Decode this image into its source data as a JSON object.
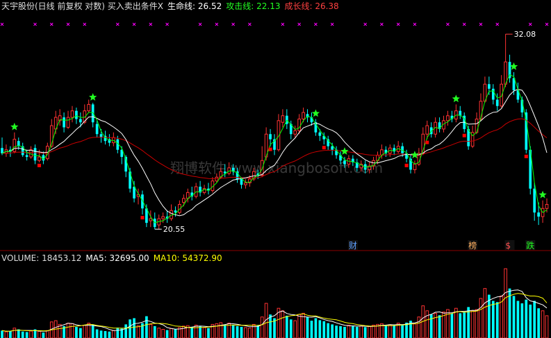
{
  "header": {
    "title": "天宇股份(日线 前复权 对数) 买入卖出条件X",
    "lifeline_label": "生命线: 26.52",
    "attack_label": "攻击线: 22.13",
    "growth_label": "成长线: 26.38"
  },
  "volume_header": {
    "volume_label": "VOLUME: 18453.12",
    "ma5_label": "MA5: 32695.00",
    "ma10_label": "MA10: 54372.90"
  },
  "watermark": "翔博软件 www.xiangbosoft.com",
  "annotations": {
    "high": "32.08",
    "low": "20.55"
  },
  "event_markers": [
    "财",
    "榜",
    "$",
    "跌"
  ],
  "colors": {
    "background": "#000000",
    "up": "#ff3232",
    "down": "#00ffff",
    "life_line": "#ffffff",
    "attack_line": "#00ff00",
    "growth_line": "#cc0000",
    "star": "#22ff22",
    "cross": "#ff00ff",
    "sell_dot": "#ff0000",
    "ma5": "#ffffff",
    "ma10": "#ffff00",
    "high_annotation": "#ff4040"
  },
  "chart_data": [
    {
      "type": "candlestick",
      "scale": "log",
      "ylim": [
        19.8,
        33.5
      ],
      "candles": [
        [
          24.7,
          24.4,
          25.3,
          24.3,
          0
        ],
        [
          24.4,
          24.6,
          24.9,
          24.2,
          0
        ],
        [
          24.6,
          24.5,
          24.8,
          24.2,
          0
        ],
        [
          24.5,
          25.2,
          25.6,
          24.4,
          0
        ],
        [
          25.1,
          24.8,
          25.3,
          24.6,
          0
        ],
        [
          24.8,
          24.3,
          25.0,
          24.2,
          0
        ],
        [
          24.3,
          24.2,
          24.6,
          24.0,
          0
        ],
        [
          24.2,
          24.6,
          24.8,
          24.1,
          0
        ],
        [
          24.7,
          24.0,
          24.9,
          23.8,
          0
        ],
        [
          24.0,
          24.2,
          24.6,
          23.9,
          0
        ],
        [
          24.3,
          24.0,
          24.5,
          23.8,
          0
        ],
        [
          24.1,
          24.8,
          25.0,
          24.0,
          0
        ],
        [
          24.8,
          26.0,
          26.4,
          24.7,
          0
        ],
        [
          25.8,
          26.5,
          26.9,
          25.5,
          0
        ],
        [
          26.3,
          26.6,
          27.0,
          26.0,
          0
        ],
        [
          26.5,
          25.9,
          26.8,
          25.6,
          0
        ],
        [
          25.9,
          26.5,
          26.9,
          25.8,
          0
        ],
        [
          26.5,
          26.9,
          27.2,
          26.2,
          0
        ],
        [
          26.9,
          26.4,
          27.1,
          26.1,
          0
        ],
        [
          26.4,
          26.2,
          26.8,
          25.9,
          0
        ],
        [
          26.2,
          26.9,
          27.3,
          26.1,
          0
        ],
        [
          26.9,
          27.3,
          27.6,
          26.8,
          0
        ],
        [
          27.3,
          26.2,
          27.4,
          25.9,
          0
        ],
        [
          26.1,
          25.5,
          26.3,
          25.3,
          0
        ],
        [
          25.5,
          25.3,
          25.8,
          25.0,
          0
        ],
        [
          25.4,
          25.1,
          25.7,
          24.9,
          0
        ],
        [
          25.2,
          25.0,
          25.5,
          24.8,
          0
        ],
        [
          25.0,
          25.3,
          25.6,
          24.8,
          0
        ],
        [
          25.2,
          24.6,
          25.4,
          24.4,
          0
        ],
        [
          24.6,
          24.2,
          24.8,
          23.8,
          0
        ],
        [
          24.2,
          23.4,
          24.3,
          23.1,
          0
        ],
        [
          23.4,
          22.5,
          23.6,
          22.3,
          0
        ],
        [
          22.6,
          22.0,
          22.9,
          21.8,
          0
        ],
        [
          22.1,
          22.2,
          22.5,
          21.7,
          0
        ],
        [
          22.2,
          21.5,
          22.4,
          21.2,
          0
        ],
        [
          21.5,
          20.8,
          21.7,
          20.6,
          0
        ],
        [
          20.9,
          21.0,
          21.4,
          20.6,
          0
        ],
        [
          21.0,
          20.6,
          21.3,
          20.5,
          0
        ],
        [
          20.7,
          21.0,
          21.2,
          20.5,
          0
        ],
        [
          21.0,
          21.1,
          21.3,
          20.8,
          0
        ],
        [
          21.1,
          21.0,
          21.4,
          20.8,
          0
        ],
        [
          21.0,
          21.4,
          21.7,
          20.9,
          0
        ],
        [
          21.4,
          21.3,
          21.6,
          21.1,
          0
        ],
        [
          21.3,
          21.7,
          21.9,
          21.2,
          0
        ],
        [
          21.8,
          22.0,
          22.2,
          21.6,
          0
        ],
        [
          22.0,
          22.3,
          22.5,
          21.8,
          0
        ],
        [
          22.3,
          22.1,
          22.6,
          21.9,
          0
        ],
        [
          22.1,
          22.6,
          22.8,
          22.0,
          0
        ],
        [
          22.6,
          22.3,
          22.9,
          22.1,
          0
        ],
        [
          22.3,
          22.5,
          22.7,
          22.2,
          0
        ],
        [
          22.5,
          22.4,
          22.8,
          22.2,
          0
        ],
        [
          22.4,
          22.9,
          23.1,
          22.3,
          0
        ],
        [
          22.9,
          23.1,
          23.3,
          22.8,
          0
        ],
        [
          23.1,
          23.4,
          23.6,
          23.0,
          0
        ],
        [
          23.4,
          23.3,
          23.8,
          23.1,
          0
        ],
        [
          23.3,
          23.6,
          23.9,
          23.2,
          0
        ],
        [
          23.6,
          23.4,
          23.8,
          23.2,
          0
        ],
        [
          23.4,
          23.0,
          23.6,
          22.8,
          0
        ],
        [
          23.0,
          22.7,
          23.1,
          22.5,
          0
        ],
        [
          22.7,
          22.8,
          23.0,
          22.5,
          0
        ],
        [
          22.8,
          23.0,
          23.2,
          22.6,
          0
        ],
        [
          23.0,
          23.4,
          23.6,
          22.9,
          0
        ],
        [
          23.3,
          23.2,
          23.5,
          23.0,
          0
        ],
        [
          23.2,
          24.0,
          24.8,
          23.1,
          0
        ],
        [
          24.2,
          25.5,
          25.9,
          24.0,
          0
        ],
        [
          25.5,
          25.2,
          25.8,
          24.8,
          0
        ],
        [
          25.2,
          24.6,
          25.5,
          24.3,
          0
        ],
        [
          24.6,
          26.3,
          26.7,
          24.5,
          0
        ],
        [
          26.2,
          26.6,
          27.0,
          25.9,
          0
        ],
        [
          26.6,
          26.1,
          27.0,
          25.8,
          0
        ],
        [
          26.1,
          25.5,
          26.3,
          25.2,
          0
        ],
        [
          25.5,
          25.7,
          26.0,
          25.3,
          0
        ],
        [
          25.7,
          26.4,
          26.7,
          25.5,
          0
        ],
        [
          26.4,
          26.8,
          27.1,
          26.2,
          0
        ],
        [
          26.7,
          26.5,
          27.0,
          26.2,
          0
        ],
        [
          26.5,
          26.2,
          26.8,
          26.0,
          0
        ],
        [
          26.2,
          25.6,
          26.4,
          25.4,
          0
        ],
        [
          25.6,
          25.4,
          25.8,
          25.1,
          0
        ],
        [
          25.4,
          25.2,
          25.6,
          24.9,
          0
        ],
        [
          25.2,
          24.8,
          25.4,
          24.6,
          0
        ],
        [
          24.8,
          24.6,
          25.0,
          24.3,
          0
        ],
        [
          24.6,
          24.3,
          24.8,
          24.1,
          0
        ],
        [
          24.3,
          24.0,
          24.5,
          23.8,
          0
        ],
        [
          24.0,
          23.8,
          24.2,
          23.6,
          0
        ],
        [
          23.8,
          24.1,
          24.3,
          23.6,
          0
        ],
        [
          24.1,
          23.9,
          24.3,
          23.7,
          0
        ],
        [
          23.9,
          23.6,
          24.1,
          23.4,
          0
        ],
        [
          23.6,
          23.8,
          24.0,
          23.4,
          0
        ],
        [
          23.8,
          23.5,
          24.0,
          23.3,
          0
        ],
        [
          23.5,
          23.7,
          23.9,
          23.3,
          0
        ],
        [
          23.7,
          24.0,
          24.2,
          23.5,
          0
        ],
        [
          24.0,
          24.3,
          24.5,
          23.8,
          0
        ],
        [
          24.3,
          24.6,
          24.9,
          24.1,
          0
        ],
        [
          24.6,
          24.4,
          24.8,
          24.2,
          0
        ],
        [
          24.4,
          24.7,
          24.9,
          24.2,
          0
        ],
        [
          24.7,
          24.5,
          24.9,
          24.3,
          0
        ],
        [
          24.5,
          24.8,
          25.1,
          24.4,
          0
        ],
        [
          24.8,
          24.4,
          25.0,
          24.2,
          0
        ],
        [
          24.4,
          24.1,
          24.6,
          23.9,
          0
        ],
        [
          24.1,
          23.5,
          24.3,
          23.3,
          0
        ],
        [
          23.5,
          23.8,
          24.0,
          23.3,
          0
        ],
        [
          23.8,
          24.4,
          24.7,
          23.7,
          0
        ],
        [
          24.4,
          25.5,
          25.9,
          24.3,
          0
        ],
        [
          25.5,
          26.0,
          26.3,
          25.2,
          0
        ],
        [
          25.9,
          25.5,
          26.2,
          25.3,
          0
        ],
        [
          25.5,
          26.2,
          26.5,
          25.3,
          0
        ],
        [
          26.2,
          25.8,
          26.5,
          25.6,
          0
        ],
        [
          25.8,
          26.3,
          26.6,
          25.6,
          0
        ],
        [
          26.3,
          26.6,
          26.9,
          26.0,
          0
        ],
        [
          26.6,
          26.4,
          26.9,
          26.2,
          0
        ],
        [
          26.4,
          26.9,
          27.3,
          26.2,
          0
        ],
        [
          26.9,
          26.6,
          27.2,
          26.4,
          0
        ],
        [
          26.6,
          25.8,
          26.8,
          25.6,
          0
        ],
        [
          25.8,
          24.8,
          26.0,
          24.6,
          0
        ],
        [
          24.8,
          25.6,
          26.0,
          24.7,
          0
        ],
        [
          25.6,
          26.4,
          26.8,
          25.5,
          0
        ],
        [
          26.4,
          27.5,
          28.0,
          26.3,
          0
        ],
        [
          27.5,
          28.6,
          29.1,
          27.4,
          0
        ],
        [
          28.6,
          28.3,
          29.1,
          27.9,
          0
        ],
        [
          28.3,
          27.6,
          28.6,
          27.3,
          0
        ],
        [
          27.6,
          27.2,
          28.0,
          26.9,
          0
        ],
        [
          27.2,
          28.6,
          29.2,
          27.1,
          0
        ],
        [
          28.6,
          30.1,
          32.08,
          28.4,
          0
        ],
        [
          30.1,
          29.0,
          30.6,
          28.7,
          0
        ],
        [
          29.0,
          28.2,
          29.4,
          27.9,
          0
        ],
        [
          28.2,
          27.6,
          28.7,
          27.4,
          0
        ],
        [
          27.6,
          26.8,
          27.8,
          26.5,
          0
        ],
        [
          26.8,
          24.6,
          27.0,
          24.4,
          0
        ],
        [
          24.6,
          22.5,
          24.8,
          22.2,
          0
        ],
        [
          22.5,
          21.3,
          22.8,
          20.9,
          0
        ],
        [
          21.3,
          21.1,
          21.8,
          20.7,
          0
        ],
        [
          21.1,
          21.5,
          21.9,
          20.8,
          0
        ],
        [
          21.5,
          21.7,
          22.0,
          21.3,
          0
        ]
      ]
    },
    {
      "type": "bar",
      "volume": [
        30,
        25,
        28,
        40,
        35,
        26,
        24,
        28,
        35,
        27,
        22,
        30,
        65,
        70,
        55,
        48,
        60,
        58,
        45,
        40,
        52,
        60,
        55,
        35,
        30,
        28,
        26,
        30,
        42,
        38,
        55,
        75,
        80,
        50,
        60,
        88,
        55,
        48,
        40,
        35,
        32,
        38,
        35,
        42,
        48,
        50,
        45,
        52,
        48,
        42,
        40,
        55,
        58,
        62,
        55,
        60,
        52,
        48,
        45,
        42,
        40,
        55,
        50,
        85,
        140,
        95,
        80,
        120,
        110,
        90,
        75,
        70,
        95,
        100,
        85,
        70,
        80,
        72,
        68,
        60,
        55,
        50,
        48,
        45,
        52,
        50,
        45,
        48,
        44,
        46,
        52,
        55,
        58,
        50,
        54,
        50,
        60,
        55,
        62,
        70,
        58,
        85,
        130,
        110,
        95,
        100,
        92,
        105,
        115,
        98,
        120,
        100,
        105,
        125,
        110,
        115,
        160,
        200,
        175,
        150,
        145,
        170,
        280,
        200,
        170,
        150,
        140,
        155,
        135,
        150,
        120,
        110,
        90
      ],
      "ylim": [
        0,
        300
      ]
    }
  ]
}
